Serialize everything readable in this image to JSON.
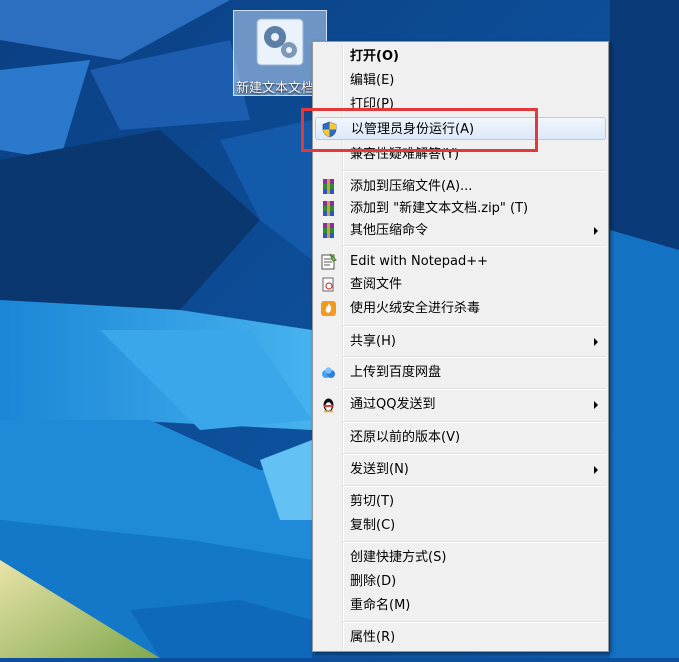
{
  "desktop": {
    "file_label": "新建文本文档.txt"
  },
  "menu": {
    "items": [
      {
        "label": "打开(O)"
      },
      {
        "label": "编辑(E)"
      },
      {
        "label": "打印(P)"
      },
      {
        "label": "以管理员身份运行(A)"
      },
      {
        "label": "兼容性疑难解答(Y)"
      },
      {
        "label": "添加到压缩文件(A)..."
      },
      {
        "label": "添加到 \"新建文本文档.zip\" (T)"
      },
      {
        "label": "其他压缩命令"
      },
      {
        "label": "Edit with Notepad++"
      },
      {
        "label": "查阅文件"
      },
      {
        "label": "使用火绒安全进行杀毒"
      },
      {
        "label": "共享(H)"
      },
      {
        "label": "上传到百度网盘"
      },
      {
        "label": "通过QQ发送到"
      },
      {
        "label": "还原以前的版本(V)"
      },
      {
        "label": "发送到(N)"
      },
      {
        "label": "剪切(T)"
      },
      {
        "label": "复制(C)"
      },
      {
        "label": "创建快捷方式(S)"
      },
      {
        "label": "删除(D)"
      },
      {
        "label": "重命名(M)"
      },
      {
        "label": "属性(R)"
      }
    ]
  },
  "icons": {
    "shield": "uac-shield-icon",
    "rar": "winrar-icon",
    "notepad": "notepad-plus-plus-icon",
    "huorong": "huorong-icon",
    "baidu": "baidu-netdisk-icon",
    "qq": "qq-penguin-icon"
  },
  "colors": {
    "highlight_border": "#e23a3a",
    "menu_bg": "#f0f0f0",
    "hover_bg": "#dce9f8"
  }
}
